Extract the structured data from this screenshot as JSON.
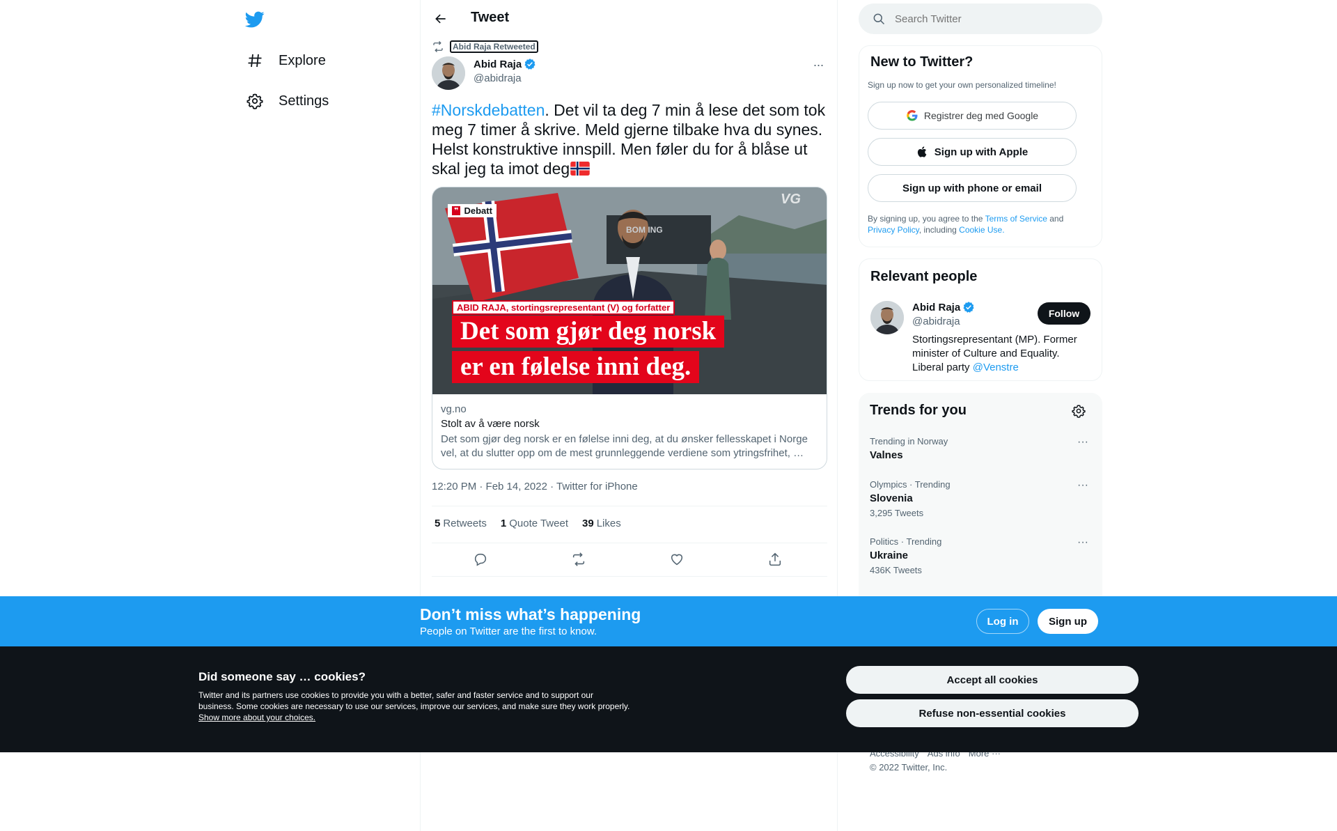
{
  "nav": {
    "items": [
      {
        "label": "Explore",
        "icon": "hashtag-icon"
      },
      {
        "label": "Settings",
        "icon": "gear-icon"
      }
    ]
  },
  "header": {
    "title": "Tweet"
  },
  "tweet": {
    "retweeted_by": "Abid Raja Retweeted",
    "author_name": "Abid Raja",
    "author_handle": "@abidraja",
    "hashtag": "#Norskdebatten",
    "text": ". Det vil ta deg 7 min å lese det som tok meg 7 timer å skrive. Meld gjerne tilbake hva du synes. Helst konstruktive innspill. Men føler du for å blåse ut skal jeg ta imot deg",
    "card": {
      "image_tag": "Debatt",
      "image_caption": "ABID RAJA, stortingsrepresentant (V) og forfatter",
      "image_headline_1": "Det som gjør deg norsk",
      "image_headline_2": "er en følelse inni deg.",
      "image_logo": "VG",
      "image_boat_text": "BOM     ING",
      "domain": "vg.no",
      "title": "Stolt av å være norsk",
      "description": "Det som gjør deg norsk er en følelse inni deg, at du ønsker fellesskapet i Norge vel, at du slutter opp om de mest grunnleggende verdiene som ytringsfrihet, …"
    },
    "timestamp": "12:20 PM · Feb 14, 2022 · Twitter for iPhone",
    "stats": {
      "retweets_count": "5",
      "retweets_label": "Retweets",
      "quotes_count": "1",
      "quotes_label": "Quote Tweet",
      "likes_count": "39",
      "likes_label": "Likes"
    }
  },
  "search": {
    "placeholder": "Search Twitter"
  },
  "new_to_twitter": {
    "title": "New to Twitter?",
    "subtitle": "Sign up now to get your own personalized timeline!",
    "google": "Registrer deg med Google",
    "apple": "Sign up with Apple",
    "phone": "Sign up with phone or email",
    "terms_pre": "By signing up, you agree to the ",
    "terms_link": "Terms of Service",
    "terms_and": " and",
    "privacy_link": "Privacy Policy",
    "including": ", including ",
    "cookie_link": "Cookie Use."
  },
  "relevant_people": {
    "title": "Relevant people",
    "name": "Abid Raja",
    "handle": "@abidraja",
    "follow": "Follow",
    "bio": "Stortingsrepresentant (MP). Former minister of Culture and Equality. Liberal party ",
    "bio_mention": "@Venstre"
  },
  "trends": {
    "title": "Trends for you",
    "items": [
      {
        "context": "Trending in Norway",
        "name": "Valnes",
        "count": ""
      },
      {
        "context": "Olympics · Trending",
        "name": "Slovenia",
        "count": "3,295 Tweets"
      },
      {
        "context": "Politics · Trending",
        "name": "Ukraine",
        "count": "436K Tweets"
      }
    ]
  },
  "footer": {
    "accessibility": "Accessibility",
    "ads": "Ads info",
    "more": "More ···",
    "copyright": "© 2022 Twitter, Inc."
  },
  "signup_bar": {
    "title": "Don’t miss what’s happening",
    "subtitle": "People on Twitter are the first to know.",
    "login": "Log in",
    "signup": "Sign up"
  },
  "cookies": {
    "title": "Did someone say … cookies?",
    "text": "Twitter and its partners use cookies to provide you with a better, safer and faster service and to support our business. Some cookies are necessary to use our services, improve our services, and make sure they work properly. ",
    "link": "Show more about your choices.",
    "accept": "Accept all cookies",
    "refuse": "Refuse non-essential cookies"
  },
  "colors": {
    "accent": "#1d9bf0",
    "text": "#0f1419",
    "muted": "#536471",
    "cookie_bg": "#0f1419"
  }
}
